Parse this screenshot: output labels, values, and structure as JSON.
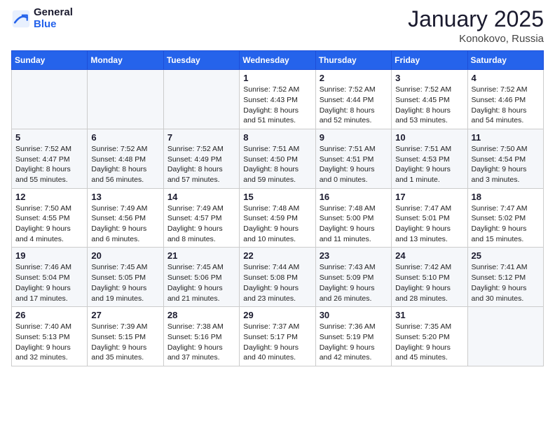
{
  "logo": {
    "general": "General",
    "blue": "Blue"
  },
  "header": {
    "month": "January 2025",
    "location": "Konokovo, Russia"
  },
  "weekdays": [
    "Sunday",
    "Monday",
    "Tuesday",
    "Wednesday",
    "Thursday",
    "Friday",
    "Saturday"
  ],
  "weeks": [
    [
      {
        "day": "",
        "sunrise": "",
        "sunset": "",
        "daylight": ""
      },
      {
        "day": "",
        "sunrise": "",
        "sunset": "",
        "daylight": ""
      },
      {
        "day": "",
        "sunrise": "",
        "sunset": "",
        "daylight": ""
      },
      {
        "day": "1",
        "sunrise": "Sunrise: 7:52 AM",
        "sunset": "Sunset: 4:43 PM",
        "daylight": "Daylight: 8 hours and 51 minutes."
      },
      {
        "day": "2",
        "sunrise": "Sunrise: 7:52 AM",
        "sunset": "Sunset: 4:44 PM",
        "daylight": "Daylight: 8 hours and 52 minutes."
      },
      {
        "day": "3",
        "sunrise": "Sunrise: 7:52 AM",
        "sunset": "Sunset: 4:45 PM",
        "daylight": "Daylight: 8 hours and 53 minutes."
      },
      {
        "day": "4",
        "sunrise": "Sunrise: 7:52 AM",
        "sunset": "Sunset: 4:46 PM",
        "daylight": "Daylight: 8 hours and 54 minutes."
      }
    ],
    [
      {
        "day": "5",
        "sunrise": "Sunrise: 7:52 AM",
        "sunset": "Sunset: 4:47 PM",
        "daylight": "Daylight: 8 hours and 55 minutes."
      },
      {
        "day": "6",
        "sunrise": "Sunrise: 7:52 AM",
        "sunset": "Sunset: 4:48 PM",
        "daylight": "Daylight: 8 hours and 56 minutes."
      },
      {
        "day": "7",
        "sunrise": "Sunrise: 7:52 AM",
        "sunset": "Sunset: 4:49 PM",
        "daylight": "Daylight: 8 hours and 57 minutes."
      },
      {
        "day": "8",
        "sunrise": "Sunrise: 7:51 AM",
        "sunset": "Sunset: 4:50 PM",
        "daylight": "Daylight: 8 hours and 59 minutes."
      },
      {
        "day": "9",
        "sunrise": "Sunrise: 7:51 AM",
        "sunset": "Sunset: 4:51 PM",
        "daylight": "Daylight: 9 hours and 0 minutes."
      },
      {
        "day": "10",
        "sunrise": "Sunrise: 7:51 AM",
        "sunset": "Sunset: 4:53 PM",
        "daylight": "Daylight: 9 hours and 1 minute."
      },
      {
        "day": "11",
        "sunrise": "Sunrise: 7:50 AM",
        "sunset": "Sunset: 4:54 PM",
        "daylight": "Daylight: 9 hours and 3 minutes."
      }
    ],
    [
      {
        "day": "12",
        "sunrise": "Sunrise: 7:50 AM",
        "sunset": "Sunset: 4:55 PM",
        "daylight": "Daylight: 9 hours and 4 minutes."
      },
      {
        "day": "13",
        "sunrise": "Sunrise: 7:49 AM",
        "sunset": "Sunset: 4:56 PM",
        "daylight": "Daylight: 9 hours and 6 minutes."
      },
      {
        "day": "14",
        "sunrise": "Sunrise: 7:49 AM",
        "sunset": "Sunset: 4:57 PM",
        "daylight": "Daylight: 9 hours and 8 minutes."
      },
      {
        "day": "15",
        "sunrise": "Sunrise: 7:48 AM",
        "sunset": "Sunset: 4:59 PM",
        "daylight": "Daylight: 9 hours and 10 minutes."
      },
      {
        "day": "16",
        "sunrise": "Sunrise: 7:48 AM",
        "sunset": "Sunset: 5:00 PM",
        "daylight": "Daylight: 9 hours and 11 minutes."
      },
      {
        "day": "17",
        "sunrise": "Sunrise: 7:47 AM",
        "sunset": "Sunset: 5:01 PM",
        "daylight": "Daylight: 9 hours and 13 minutes."
      },
      {
        "day": "18",
        "sunrise": "Sunrise: 7:47 AM",
        "sunset": "Sunset: 5:02 PM",
        "daylight": "Daylight: 9 hours and 15 minutes."
      }
    ],
    [
      {
        "day": "19",
        "sunrise": "Sunrise: 7:46 AM",
        "sunset": "Sunset: 5:04 PM",
        "daylight": "Daylight: 9 hours and 17 minutes."
      },
      {
        "day": "20",
        "sunrise": "Sunrise: 7:45 AM",
        "sunset": "Sunset: 5:05 PM",
        "daylight": "Daylight: 9 hours and 19 minutes."
      },
      {
        "day": "21",
        "sunrise": "Sunrise: 7:45 AM",
        "sunset": "Sunset: 5:06 PM",
        "daylight": "Daylight: 9 hours and 21 minutes."
      },
      {
        "day": "22",
        "sunrise": "Sunrise: 7:44 AM",
        "sunset": "Sunset: 5:08 PM",
        "daylight": "Daylight: 9 hours and 23 minutes."
      },
      {
        "day": "23",
        "sunrise": "Sunrise: 7:43 AM",
        "sunset": "Sunset: 5:09 PM",
        "daylight": "Daylight: 9 hours and 26 minutes."
      },
      {
        "day": "24",
        "sunrise": "Sunrise: 7:42 AM",
        "sunset": "Sunset: 5:10 PM",
        "daylight": "Daylight: 9 hours and 28 minutes."
      },
      {
        "day": "25",
        "sunrise": "Sunrise: 7:41 AM",
        "sunset": "Sunset: 5:12 PM",
        "daylight": "Daylight: 9 hours and 30 minutes."
      }
    ],
    [
      {
        "day": "26",
        "sunrise": "Sunrise: 7:40 AM",
        "sunset": "Sunset: 5:13 PM",
        "daylight": "Daylight: 9 hours and 32 minutes."
      },
      {
        "day": "27",
        "sunrise": "Sunrise: 7:39 AM",
        "sunset": "Sunset: 5:15 PM",
        "daylight": "Daylight: 9 hours and 35 minutes."
      },
      {
        "day": "28",
        "sunrise": "Sunrise: 7:38 AM",
        "sunset": "Sunset: 5:16 PM",
        "daylight": "Daylight: 9 hours and 37 minutes."
      },
      {
        "day": "29",
        "sunrise": "Sunrise: 7:37 AM",
        "sunset": "Sunset: 5:17 PM",
        "daylight": "Daylight: 9 hours and 40 minutes."
      },
      {
        "day": "30",
        "sunrise": "Sunrise: 7:36 AM",
        "sunset": "Sunset: 5:19 PM",
        "daylight": "Daylight: 9 hours and 42 minutes."
      },
      {
        "day": "31",
        "sunrise": "Sunrise: 7:35 AM",
        "sunset": "Sunset: 5:20 PM",
        "daylight": "Daylight: 9 hours and 45 minutes."
      },
      {
        "day": "",
        "sunrise": "",
        "sunset": "",
        "daylight": ""
      }
    ]
  ]
}
